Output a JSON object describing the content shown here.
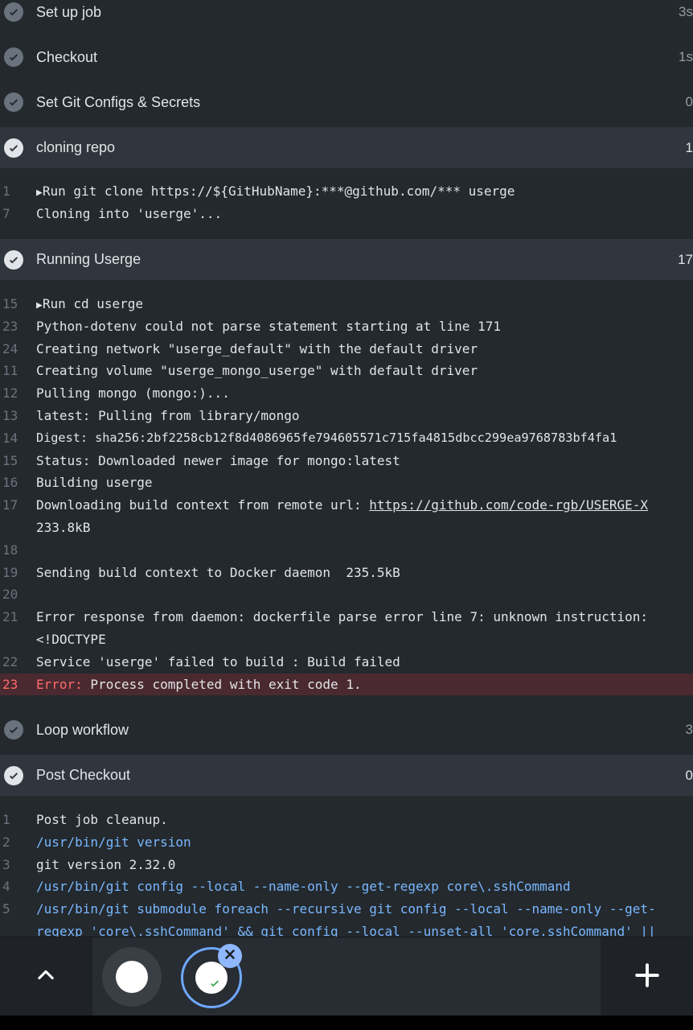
{
  "steps": [
    {
      "label": "Set up job",
      "duration": "3s"
    },
    {
      "label": "Checkout",
      "duration": "1s"
    },
    {
      "label": "Set Git Configs & Secrets",
      "duration": "0"
    },
    {
      "label": "cloning repo",
      "duration": "1"
    },
    {
      "label": "Running Userge",
      "duration": "17"
    },
    {
      "label": "Loop workflow",
      "duration": "3"
    },
    {
      "label": "Post Checkout",
      "duration": "0"
    }
  ],
  "cloning_log": [
    {
      "num": "1",
      "text": "Run git clone https://${GitHubName}:***@github.com/*** userge"
    },
    {
      "num": "7",
      "text": "Cloning into 'userge'..."
    }
  ],
  "running_log": [
    {
      "num": "15",
      "text": "Run cd userge"
    },
    {
      "num": "23",
      "text": "Python-dotenv could not parse statement starting at line 171"
    },
    {
      "num": "24",
      "text": "Creating network \"userge_default\" with the default driver"
    },
    {
      "num": "11",
      "text": "Creating volume \"userge_mongo_userge\" with default driver"
    },
    {
      "num": "12",
      "text": "Pulling mongo (mongo:)..."
    },
    {
      "num": "13",
      "text": "latest: Pulling from library/mongo"
    },
    {
      "num": "14",
      "text": "Digest: sha256:2bf2258cb12f8d4086965fe794605571c715fa4815dbcc299ea9768783bf4fa1"
    },
    {
      "num": "15",
      "text": "Status: Downloaded newer image for mongo:latest"
    },
    {
      "num": "16",
      "text": "Building userge"
    },
    {
      "num": "17",
      "text": "Downloading build context from remote url: ",
      "link": "https://github.com/code-rgb/USERGE-X"
    },
    {
      "num": "",
      "text": "233.8kB"
    },
    {
      "num": "18",
      "text": ""
    },
    {
      "num": "19",
      "text": "Sending build context to Docker daemon  235.5kB"
    },
    {
      "num": "20",
      "text": ""
    },
    {
      "num": "21",
      "text": "Error response from daemon: dockerfile parse error line 7: unknown instruction:"
    },
    {
      "num": "",
      "text": "<!DOCTYPE"
    },
    {
      "num": "22",
      "text": "Service 'userge' failed to build : Build failed"
    },
    {
      "num": "23",
      "error_label": "Error:",
      "text": " Process completed with exit code 1."
    }
  ],
  "post_log": [
    {
      "num": "1",
      "text": "Post job cleanup."
    },
    {
      "num": "2",
      "text": "/usr/bin/git version"
    },
    {
      "num": "3",
      "text": "git version 2.32.0"
    },
    {
      "num": "4",
      "text": "/usr/bin/git config --local --name-only --get-regexp core\\.sshCommand"
    },
    {
      "num": "5",
      "text": "/usr/bin/git submodule foreach --recursive git config --local --name-only --get-"
    },
    {
      "num": "",
      "text": "regexp 'core\\.sshCommand' && git config --local --unset-all 'core.sshCommand' ||"
    }
  ],
  "colors": {
    "background": "#24292e",
    "expanded_header": "#2f363d",
    "error_row": "#4a2a30",
    "error_text": "#ff6b6b",
    "command_blue": "#79b8ff"
  },
  "icons": {
    "step_status": "check-circle-icon",
    "collapse": "chevron-up-icon",
    "new_tab": "plus-icon",
    "close_tab": "close-icon"
  }
}
